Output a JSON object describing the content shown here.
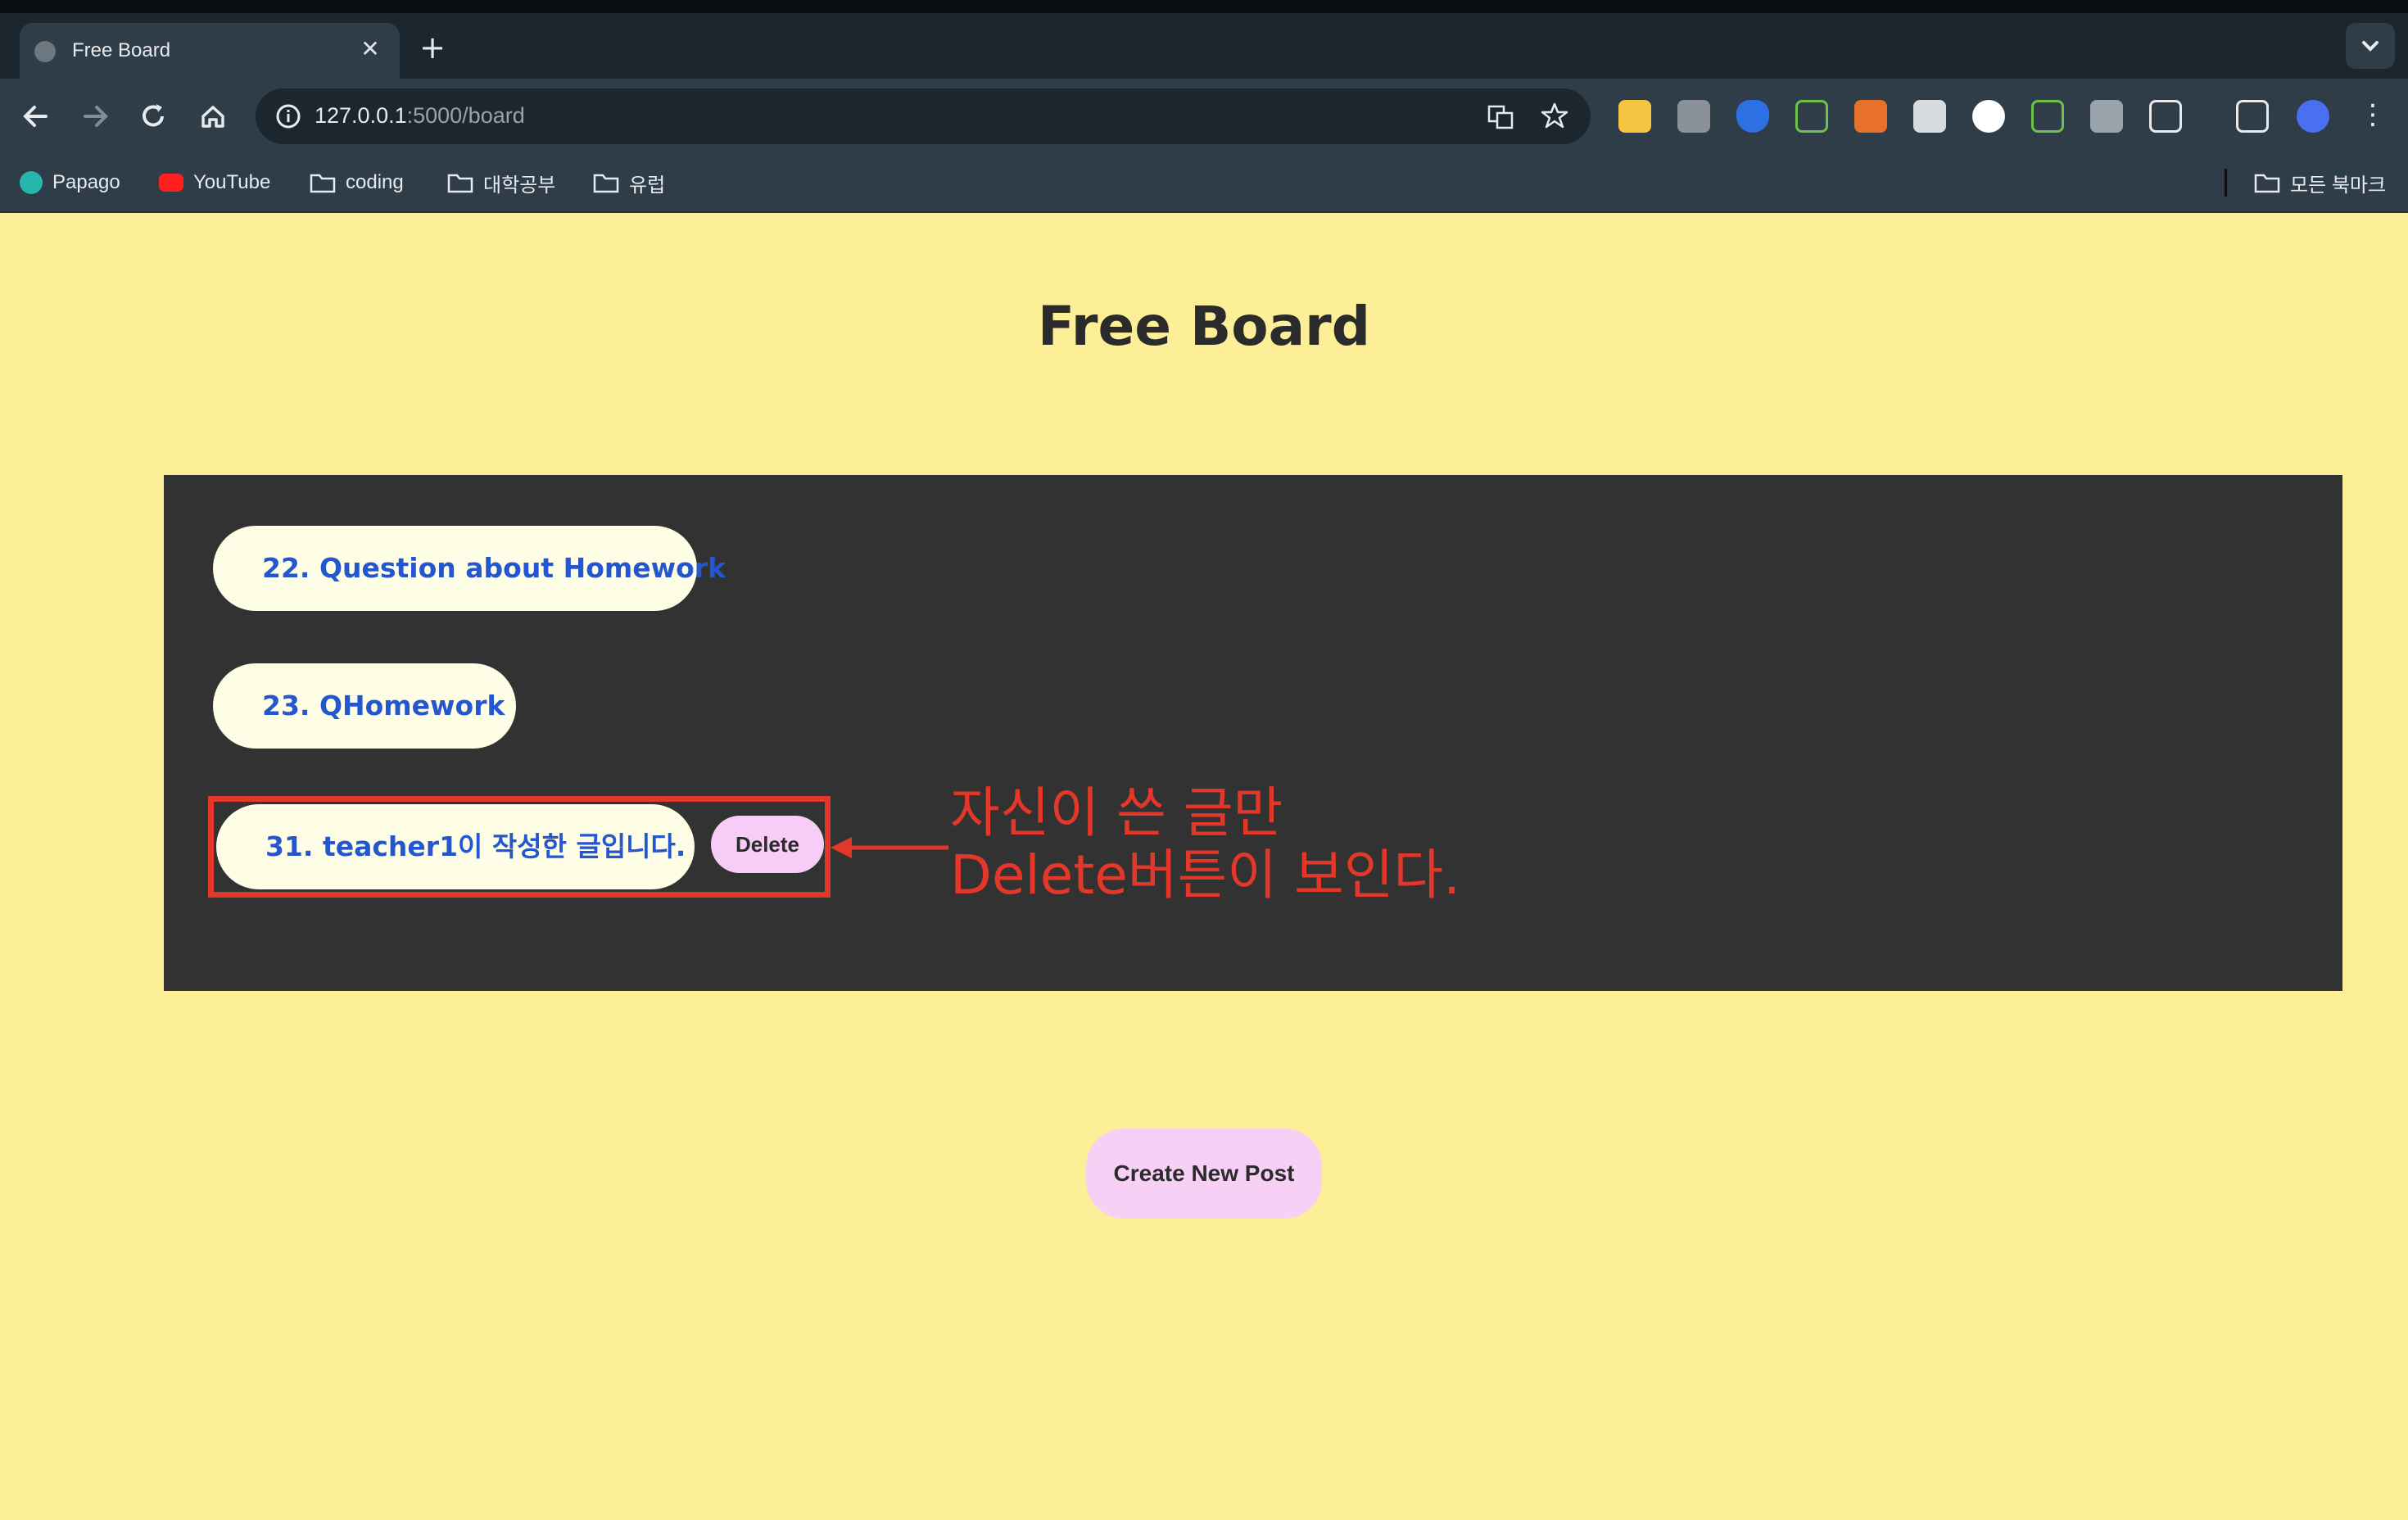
{
  "browser": {
    "tab_title": "Free Board",
    "new_tab": "+",
    "close": "✕",
    "url_host": "127.0.0.1",
    "url_rest": ":5000/board",
    "bookmarks": [
      "Papago",
      "YouTube",
      "coding",
      "대학공부",
      "유럽"
    ],
    "all_bookmarks": "모든 북마크"
  },
  "page": {
    "title": "Free Board",
    "posts": [
      {
        "label": "22. Question about Homework"
      },
      {
        "label": "23. QHomework"
      },
      {
        "label": "31. teacher1이 작성한 글입니다."
      }
    ],
    "delete_label": "Delete",
    "create_label": "Create New Post",
    "annotation_line1": "자신이 쓴 글만",
    "annotation_line2": "Delete버튼이 보인다."
  },
  "colors": {
    "background": "#fdee98",
    "panel": "#323232",
    "post_pill": "#fefde5",
    "post_text": "#2456cf",
    "button_pink": "#f6d0f5",
    "annotation_red": "#e3372a"
  }
}
